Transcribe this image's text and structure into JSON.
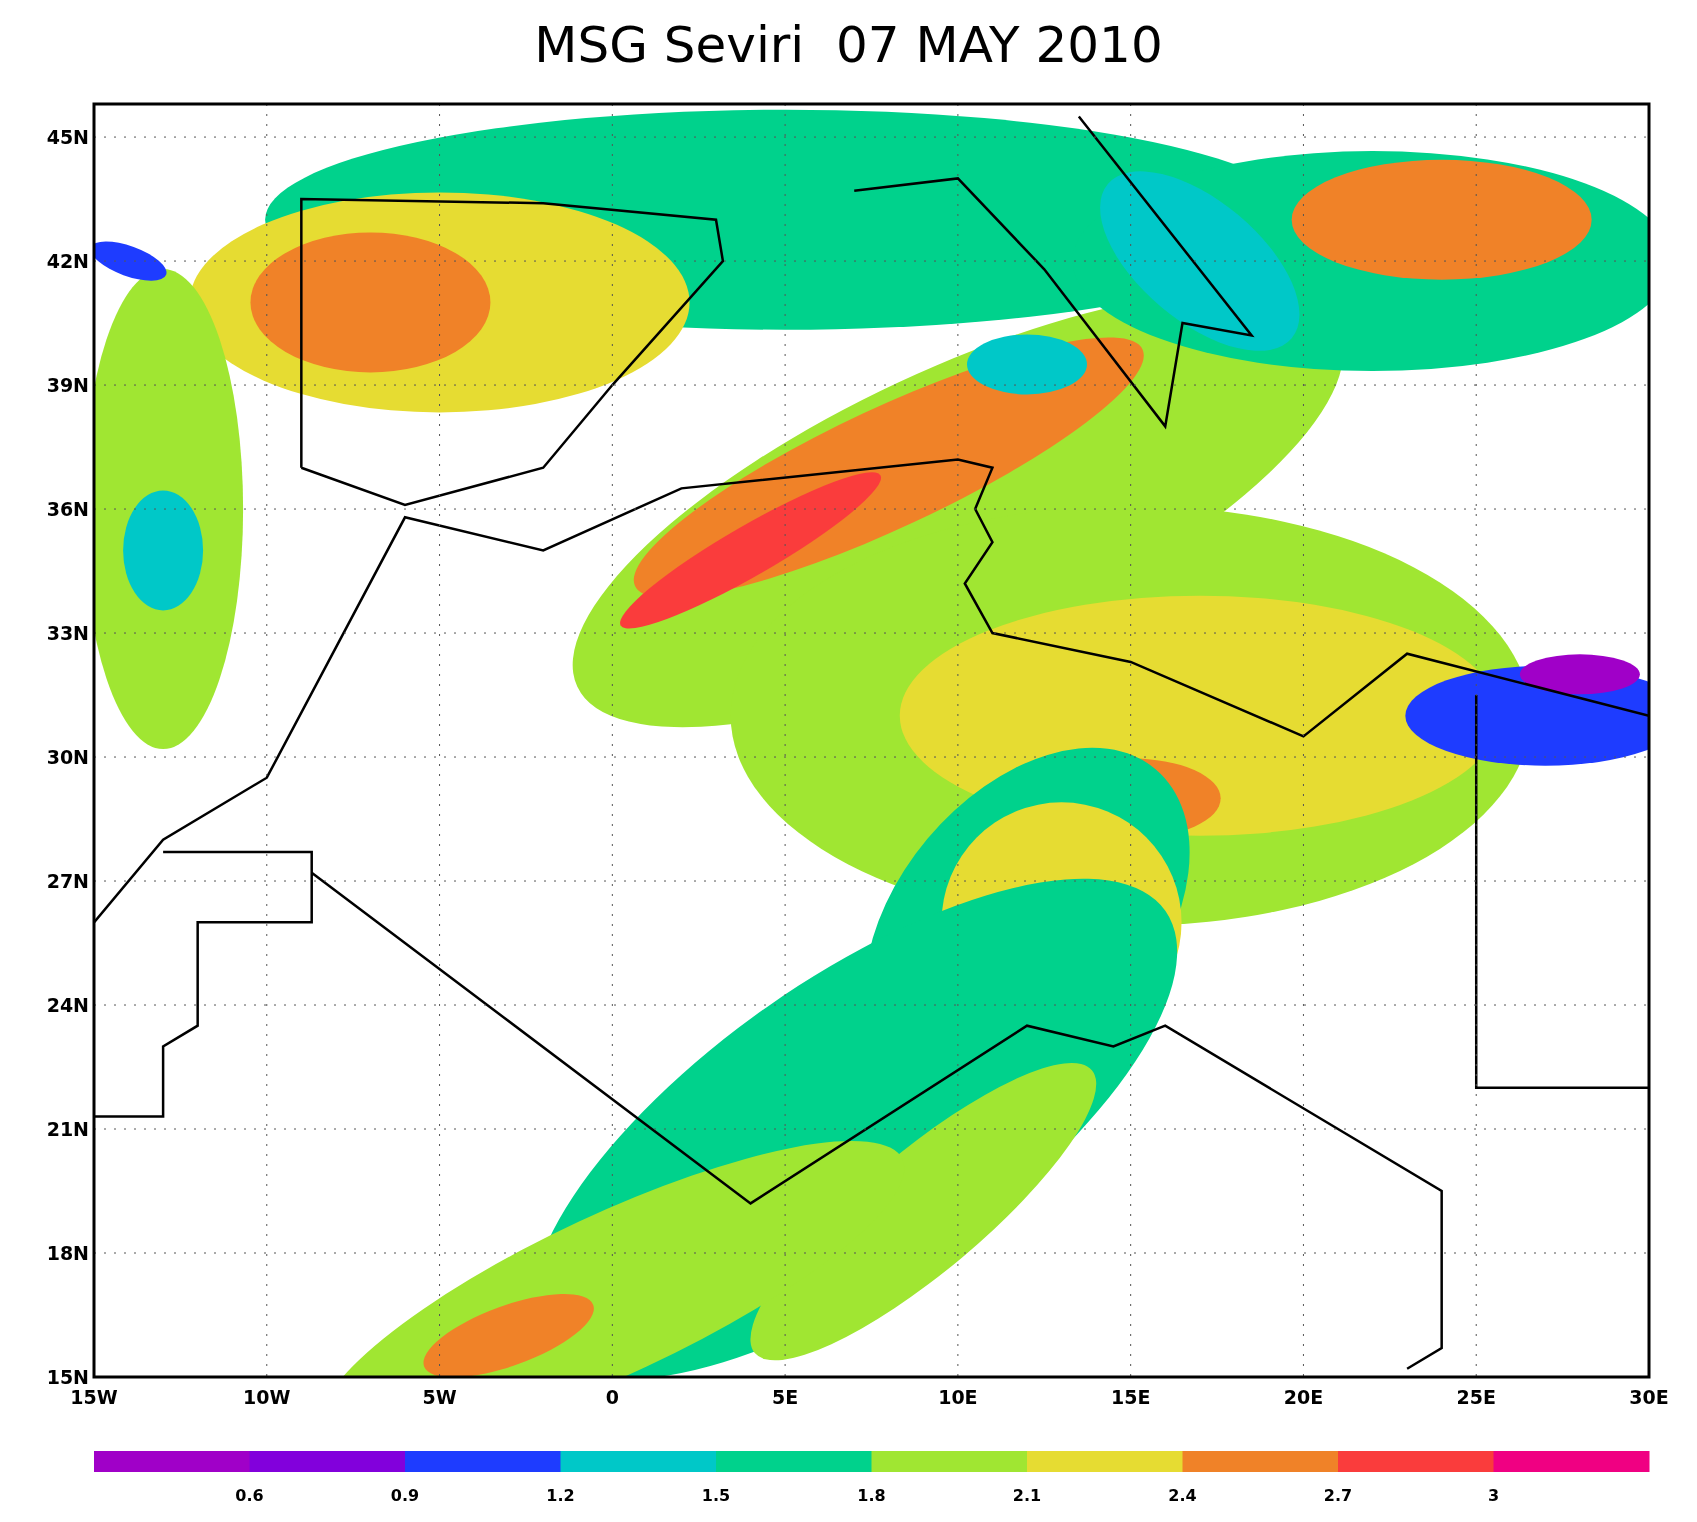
{
  "title": "MSG Seviri  07 MAY 2010",
  "map": {
    "x_ticks": [
      "15W",
      "10W",
      "5W",
      "0",
      "5E",
      "10E",
      "15E",
      "20E",
      "25E",
      "30E"
    ],
    "y_ticks": [
      "45N",
      "42N",
      "39N",
      "36N",
      "33N",
      "30N",
      "27N",
      "24N",
      "21N",
      "18N",
      "15N"
    ]
  },
  "colorbar": {
    "segments": [
      {
        "color": "#a000c8"
      },
      {
        "color": "#8200dc"
      },
      {
        "color": "#1e3cff"
      },
      {
        "color": "#00c8c8"
      },
      {
        "color": "#00d28c"
      },
      {
        "color": "#a0e632"
      },
      {
        "color": "#e6dc32"
      },
      {
        "color": "#f08228"
      },
      {
        "color": "#fa3c3c"
      },
      {
        "color": "#f00082"
      }
    ],
    "labels": [
      "0.6",
      "0.9",
      "1.2",
      "1.5",
      "1.8",
      "2.1",
      "2.4",
      "2.7",
      "3"
    ]
  }
}
